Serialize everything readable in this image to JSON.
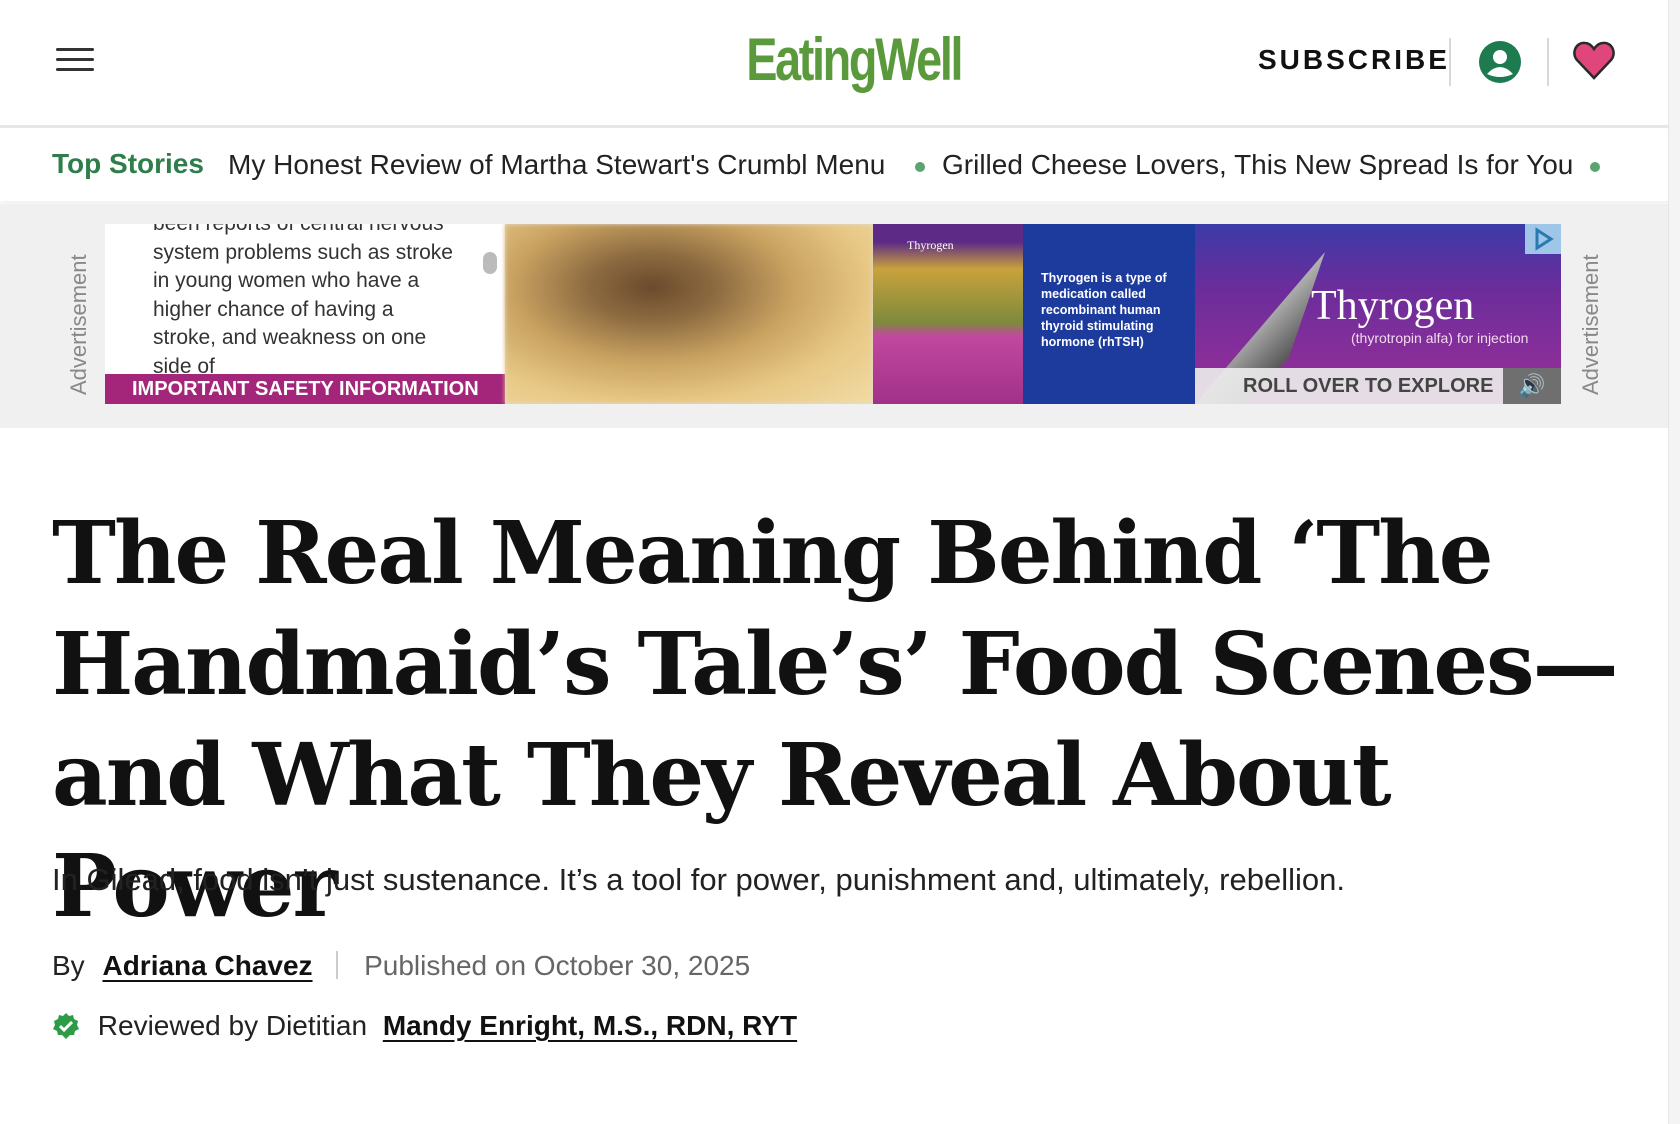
{
  "header": {
    "logo_text": "EatingWell",
    "subscribe_label": "SUBSCRIBE",
    "menu_icon": "hamburger-menu-icon",
    "account_icon": "account-icon",
    "favorites_icon": "heart-icon"
  },
  "top_stories": {
    "label": "Top Stories",
    "items": [
      "My Honest Review of Martha Stewart's Crumbl Menu",
      "Grilled Cheese Lovers, This New Spread Is for You"
    ]
  },
  "ad": {
    "side_label": "Advertisement",
    "isi_text": "been reports of central nervous system problems such as stroke in young women who have a higher chance of having a stroke, and weakness on one side of",
    "isi_button": "IMPORTANT SAFETY INFORMATION",
    "tile_brand": "Thyrogen",
    "tile_text": "Thyrogen is a type of medication called recombinant human thyroid stimulating hormone (rhTSH)",
    "brand": "Thyrogen",
    "brand_sub": "(thyrotropin alfa) for injection",
    "cta": "ROLL OVER TO EXPLORE"
  },
  "article": {
    "title": "The Real Meaning Behind ‘The Handmaid’s Tale’s’ Food Scenes—and What They Reveal About Power",
    "dek": "In Gilead, food isn’t just sustenance. It’s a tool for power, punishment and, ultimately, rebellion.",
    "by_label": "By",
    "author": "Adriana Chavez",
    "published": "Published on October 30, 2025",
    "reviewed_label": "Reviewed by Dietitian",
    "reviewer": "Mandy Enright, M.S., RDN, RYT"
  },
  "colors": {
    "brand_green": "#5a9a3c",
    "top_stories_green": "#2e7d4a",
    "heart_pink": "#e0457b",
    "ad_magenta": "#a3267a"
  }
}
